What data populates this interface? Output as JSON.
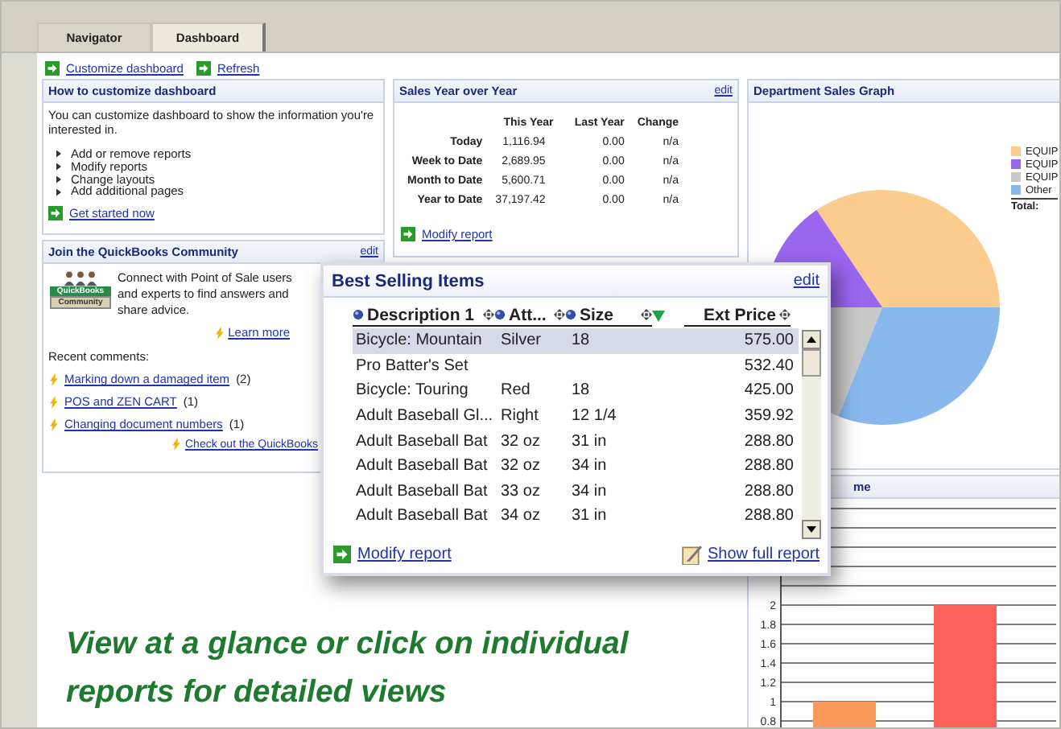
{
  "tabs": [
    {
      "label": "Navigator",
      "selected": false
    },
    {
      "label": "Dashboard",
      "selected": true
    }
  ],
  "toolbar_links": [
    "Customize dashboard",
    "Refresh"
  ],
  "customize_panel": {
    "title": "How to customize dashboard",
    "intro": "You can customize dashboard to show the information you're interested in.",
    "bullets": [
      "Add or remove reports",
      "Modify reports",
      "Change layouts",
      "Add additional pages"
    ],
    "link": "Get started now"
  },
  "community_panel": {
    "title": "Join the QuickBooks Community",
    "edit": "edit",
    "logo_lines": [
      "QuickBooks",
      "Community"
    ],
    "text": "Connect with Point of Sale users and experts to find answers and share advice.",
    "learn_more": "Learn more",
    "recent_label": "Recent comments:",
    "comments": [
      {
        "title": "Marking down a damaged item",
        "count": "(2)"
      },
      {
        "title": "POS and ZEN CART",
        "count": "(1)"
      },
      {
        "title": "Changing document numbers",
        "count": "(1)"
      }
    ],
    "check_out": "Check out the QuickBooks"
  },
  "sales_panel": {
    "title": "Sales Year over Year",
    "edit": "edit",
    "columns": [
      "This Year",
      "Last Year",
      "Change"
    ],
    "rows": [
      {
        "label": "Today",
        "cells": [
          "1,116.94",
          "0.00",
          "n/a"
        ]
      },
      {
        "label": "Week to Date",
        "cells": [
          "2,689.95",
          "0.00",
          "n/a"
        ]
      },
      {
        "label": "Month to Date",
        "cells": [
          "5,600.71",
          "0.00",
          "n/a"
        ]
      },
      {
        "label": "Year to Date",
        "cells": [
          "37,197.42",
          "0.00",
          "n/a"
        ]
      }
    ],
    "link": "Modify report"
  },
  "department_panel": {
    "title": "Department Sales Graph",
    "legend": [
      {
        "label": "EQUIP",
        "color": "#fccb8e"
      },
      {
        "label": "EQUIP",
        "color": "#9966ee"
      },
      {
        "label": "EQUIP",
        "color": "#c8c8c8"
      },
      {
        "label": "Other",
        "color": "#88b8ec"
      }
    ],
    "total_label": "Total:"
  },
  "bar_panel": {
    "title": "me",
    "chart_data": {
      "type": "bar",
      "values": [
        1,
        2
      ],
      "ylim": [
        0,
        3.1
      ],
      "yticks": [
        0.8,
        1,
        1.2,
        1.4,
        1.6,
        1.8,
        2
      ],
      "grid": true
    }
  },
  "popup": {
    "title": "Best Selling Items",
    "edit": "edit",
    "columns": [
      {
        "label": "Description 1",
        "kind": "text"
      },
      {
        "label": "Att...",
        "kind": "text"
      },
      {
        "label": "Size",
        "kind": "text"
      },
      {
        "kind": "sort"
      },
      {
        "label": "Ext Price",
        "kind": "number"
      }
    ],
    "rows": [
      {
        "cells": [
          "Bicycle: Mountain",
          "Silver",
          "18",
          "575.00"
        ],
        "selected": true
      },
      {
        "cells": [
          "Pro Batter's Set",
          "",
          "",
          "532.40"
        ],
        "selected": false
      },
      {
        "cells": [
          "Bicycle: Touring",
          "Red",
          "18",
          "425.00"
        ],
        "selected": false
      },
      {
        "cells": [
          "Adult Baseball Gl...",
          "Right",
          "12 1/4",
          "359.92"
        ],
        "selected": false
      },
      {
        "cells": [
          "Adult Baseball Bat",
          "32 oz",
          "31 in",
          "288.80"
        ],
        "selected": false
      },
      {
        "cells": [
          "Adult Baseball Bat",
          "32 oz",
          "34 in",
          "288.80"
        ],
        "selected": false
      },
      {
        "cells": [
          "Adult Baseball Bat",
          "33 oz",
          "34 in",
          "288.80"
        ],
        "selected": false
      },
      {
        "cells": [
          "Adult Baseball Bat",
          "34 oz",
          "31 in",
          "288.80"
        ],
        "selected": false
      }
    ],
    "modify": "Modify report",
    "show_full": "Show full report"
  },
  "caption": {
    "lines": [
      "View at a glance or click on individual",
      "reports for detailed views"
    ]
  }
}
